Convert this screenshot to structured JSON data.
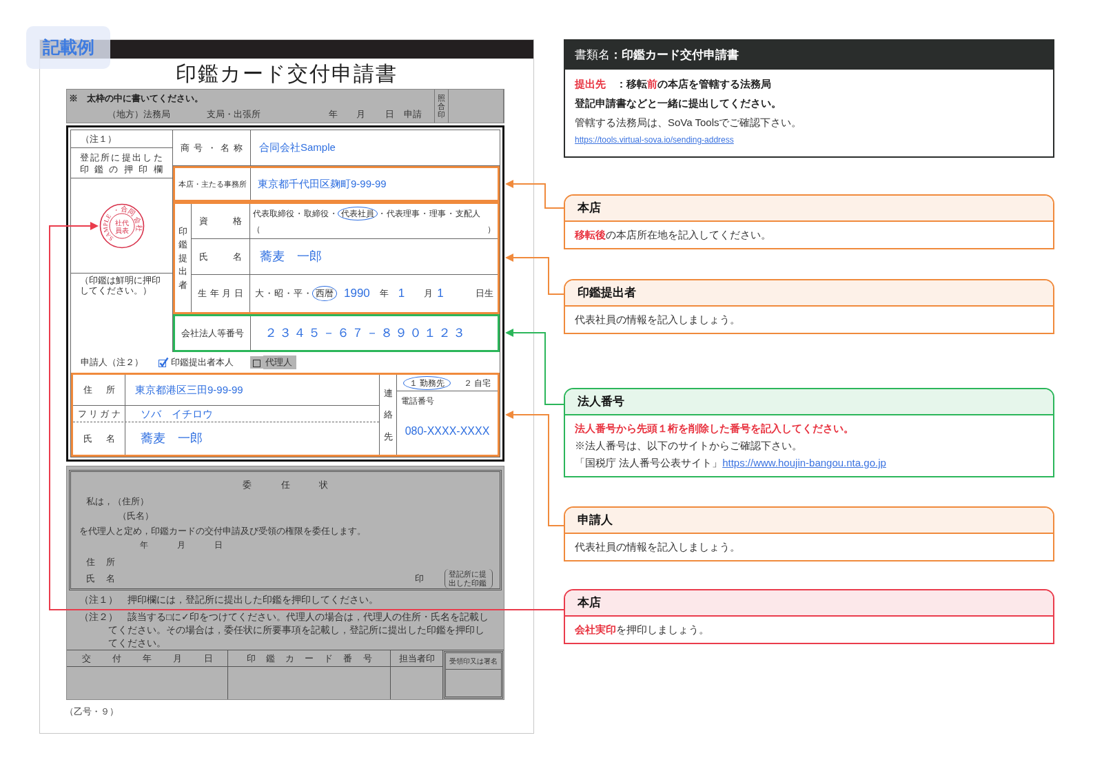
{
  "badge": {
    "label": "記載例"
  },
  "form": {
    "title": "印鑑カード交付申請書",
    "header": {
      "instruction": "※　太枠の中に書いてください。",
      "office_fields": [
        "（地方）法務局",
        "支局・出張所",
        "年",
        "月",
        "日",
        "申請"
      ],
      "verification_seal": "照合印"
    },
    "seal_column": {
      "note": "（注１）",
      "label": "登記所に提出した印鑑の押印欄",
      "stamp": {
        "ring_text": "SAMPLE・合同会社",
        "center_text": "代表社員"
      },
      "hint": "（印鑑は鮮明に押印してください。）"
    },
    "company_name": {
      "label": "商号・名称",
      "value": "合同会社Sample"
    },
    "head_office": {
      "label": "本店・主たる事務所",
      "value": "東京都千代田区麹町9-99-99"
    },
    "submitter": {
      "label": "印鑑提出者",
      "separator": "・",
      "qualification": {
        "label": "資格",
        "options": [
          {
            "label": "代表取締役",
            "selected": false
          },
          {
            "label": "取締役",
            "selected": false
          },
          {
            "label": "代表社員",
            "selected": true
          },
          {
            "label": "代表理事",
            "selected": false
          },
          {
            "label": "理事",
            "selected": false
          },
          {
            "label": "支配人",
            "selected": false
          }
        ],
        "other_open": "（",
        "other_close": "）"
      },
      "name": {
        "label": "氏名",
        "value": "蕎麦　一郎"
      },
      "birth_date": {
        "label": "生年月日",
        "eras": [
          {
            "label": "大",
            "selected": false
          },
          {
            "label": "昭",
            "selected": false
          },
          {
            "label": "平",
            "selected": false
          },
          {
            "label": "西暦",
            "selected": true
          }
        ],
        "year": "1990",
        "year_unit": "年",
        "month": "1",
        "month_unit": "月",
        "day": "1",
        "day_unit": "日生"
      }
    },
    "corporate_number": {
      "label": "会社法人等番号",
      "value": "２３４５－６７－８９０１２３"
    },
    "applicant": {
      "label": "申請人（注２）",
      "options": [
        {
          "kind": "self",
          "label": "印鑑提出者本人",
          "checked": true
        },
        {
          "kind": "agent",
          "label": "代理人",
          "checked": false
        }
      ],
      "address": {
        "label": "住所",
        "value": "東京都港区三田9-99-99"
      },
      "furigana": {
        "label": "フリガナ",
        "value": "ソバ　イチロウ"
      },
      "name": {
        "label": "氏名",
        "value": "蕎麦　一郎"
      },
      "contact": {
        "label": "連絡先",
        "places": [
          {
            "label": "１ 勤務先",
            "selected": true
          },
          {
            "label": "２ 自宅",
            "selected": false
          }
        ],
        "phone_label": "電話番号",
        "phone": "080-XXXX-XXXX"
      }
    },
    "proxy": {
      "title": "委任状",
      "lines": [
        "私は，（住所）",
        "（氏名）",
        "を代理人と定め，印鑑カードの交付申請及び受領の権限を委任します。"
      ],
      "date_fields": [
        "年",
        "月",
        "日"
      ],
      "address_label": "住所",
      "name_label": "氏名",
      "seal_mark": "印",
      "seal_note": "登記所に提出した印鑑"
    },
    "notes": [
      "（注１）　押印欄には，登記所に提出した印鑑を押印してください。",
      "（注２）　該当する□に✓印をつけてください。代理人の場合は，代理人の住所・氏名を記載してください。その場合は，委任状に所要事項を記載し，登記所に提出した印鑑を押印してください。"
    ],
    "office_use": {
      "columns": [
        "交付年月日",
        "印鑑カード番号",
        "担当者印",
        "受領印又は署名"
      ]
    },
    "form_number": "（乙号・９）"
  },
  "document_info": {
    "title": "書類名**：印鑑カード交付申請書**",
    "lines": [
      {
        "kind": "bold",
        "text": "**提出先**　：移転**前**の本店を管轄する法務局"
      },
      {
        "kind": "bold",
        "text": "登記申請書などと一緒に提出してください。"
      },
      {
        "kind": "plain",
        "text": "管轄する法務局は、SoVa Toolsでご確認下さい。"
      },
      {
        "kind": "link",
        "text": "https://tools.virtual-sova.io/sending-address"
      }
    ]
  },
  "callouts": [
    {
      "title": "本店",
      "color": "#f08a3c",
      "lines": [
        {
          "kind": "plain",
          "text": "**移転後**の本店所在地を記入してください。"
        }
      ]
    },
    {
      "title": "印鑑提出者",
      "color": "#f08a3c",
      "lines": [
        {
          "kind": "plain",
          "text": "代表社員の情報を記入しましょう。"
        }
      ]
    },
    {
      "title": "法人番号",
      "color": "#2bb65a",
      "lines": [
        {
          "kind": "alert",
          "text": "法人番号から先頭１桁を削除した番号を記入してください。"
        },
        {
          "kind": "plain",
          "text": "※法人番号は、以下のサイトからご確認下さい。"
        },
        {
          "kind": "plain",
          "text": "「国税庁 法人番号公表サイト」",
          "link": "https://www.houjin-bangou.nta.go.jp"
        }
      ]
    },
    {
      "title": "申請人",
      "color": "#f08a3c",
      "lines": [
        {
          "kind": "plain",
          "text": "代表社員の情報を記入しましょう。"
        }
      ]
    },
    {
      "title": "本店",
      "color": "#ea3c4c",
      "lines": [
        {
          "kind": "plain",
          "text": "**会社実印**を押印しましょう。"
        }
      ]
    }
  ]
}
